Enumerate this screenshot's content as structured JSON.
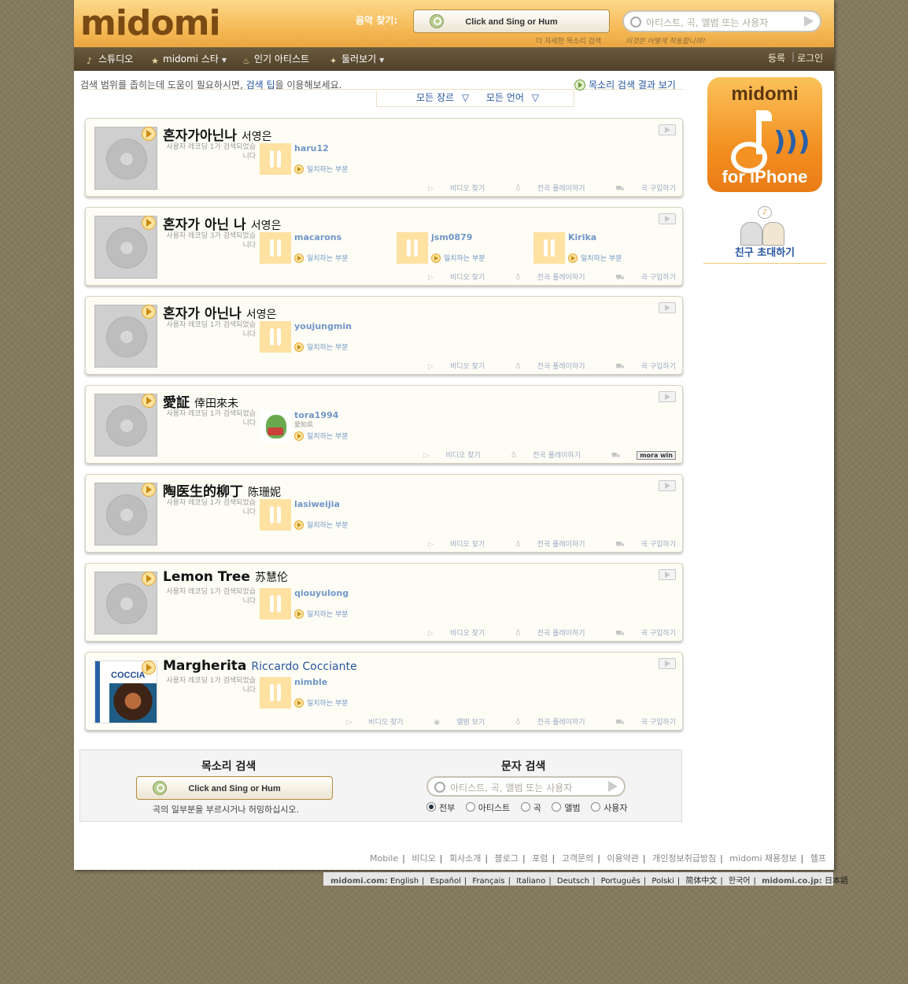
{
  "header": {
    "logo": "midomi",
    "find_music_label": "음악 찾기:",
    "voice_button": "Click and Sing or Hum",
    "search_placeholder": "아티스트, 곡, 앨범 또는 사용자",
    "voice_more": "더 자세한 목소리 검색",
    "how_it_works": "이것은 어떻게 작동합니까?"
  },
  "nav": {
    "items": [
      {
        "label": "스튜디오",
        "icon": "microphone-icon"
      },
      {
        "label": "midomi 스타",
        "icon": "star-icon",
        "dropdown": true
      },
      {
        "label": "인기 아티스트",
        "icon": "flame-icon"
      },
      {
        "label": "둘러보기",
        "icon": "bulb-icon",
        "dropdown": true
      }
    ],
    "register": "등록",
    "login": "로그인"
  },
  "tip": {
    "prefix": "검색 범위를 좁히는데 도움이 필요하시면,",
    "link": "검색 팁",
    "suffix": "을 이용해보세요.",
    "voice_results": "목소리 검색 결과 보기"
  },
  "filters": {
    "genre": "모든 장르",
    "language": "모든 언어"
  },
  "actions": {
    "video": "비디오 찾기",
    "album": "앨범 보기",
    "playlist": "전곡 플레이하기",
    "buy": "곡 구입하기",
    "mora": "mora win"
  },
  "results": [
    {
      "title": "혼자가아닌나",
      "artist": "서영은",
      "rec_count": "사용자 레코딩 1가 검색되었습니다",
      "users": [
        {
          "name": "haru12",
          "match": "일치하는 부분"
        }
      ]
    },
    {
      "title": "혼자가 아닌 나",
      "artist": "서영은",
      "rec_count": "사용자 레코딩 3가 검색되었습니다",
      "users": [
        {
          "name": "macarons",
          "match": "일치하는 부분"
        },
        {
          "name": "jsm0879",
          "match": "일치하는 부분"
        },
        {
          "name": "Kirika",
          "match": "일치하는 부분"
        }
      ]
    },
    {
      "title": "혼자가 아닌나",
      "artist": "서영은",
      "rec_count": "사용자 레코딩 1가 검색되었습니다",
      "users": [
        {
          "name": "youjungmin",
          "match": "일치하는 부분"
        }
      ]
    },
    {
      "title": "愛証",
      "artist": "倖田來未",
      "rec_count": "사용자 레코딩 1가 검색되었습니다",
      "users": [
        {
          "name": "tora1994",
          "location": "愛知県",
          "match": "일치하는 부분"
        }
      ]
    },
    {
      "title": "陶医生的柳丁",
      "artist": "陈珊妮",
      "rec_count": "사용자 레코딩 1가 검색되었습니다",
      "users": [
        {
          "name": "lasiweijia",
          "match": "일치하는 부분"
        }
      ]
    },
    {
      "title": "Lemon Tree",
      "artist": "苏慧伦",
      "rec_count": "사용자 레코딩 1가 검색되었습니다",
      "users": [
        {
          "name": "qiouyulong",
          "match": "일치하는 부분"
        }
      ]
    },
    {
      "title": "Margherita",
      "artist": "Riccardo Cocciante",
      "rec_count": "사용자 레코딩 1가 검색되었습니다",
      "album_label": "COCCIA",
      "users": [
        {
          "name": "nimble",
          "match": "일치하는 부분"
        }
      ]
    }
  ],
  "sidebar": {
    "iphone_top": "midomi",
    "iphone_bottom": "for iPhone",
    "invite": "친구 초대하기"
  },
  "bottom": {
    "voice_heading": "목소리 검색",
    "voice_button": "Click and Sing or Hum",
    "voice_hint": "곡의 일부분을 부르시거나 허밍하십시오.",
    "text_heading": "문자 검색",
    "text_placeholder": "아티스트, 곡, 앨범 또는 사용자",
    "radios": [
      {
        "label": "전부",
        "checked": true
      },
      {
        "label": "아티스트",
        "checked": false
      },
      {
        "label": "곡",
        "checked": false
      },
      {
        "label": "앨범",
        "checked": false
      },
      {
        "label": "사용자",
        "checked": false
      }
    ]
  },
  "footer": {
    "links": [
      "Mobile",
      "비디오",
      "회사소개",
      "블로그",
      "포럼",
      "고객문의",
      "이용약관",
      "개인정보취급방침",
      "midomi 채용정보",
      "헬프"
    ],
    "lang_prefix": "midomi.com:",
    "languages": [
      "English",
      "Español",
      "Français",
      "Italiano",
      "Deutsch",
      "Português",
      "Polski",
      "简体中文",
      "한국어"
    ],
    "jp_prefix": "midomi.co.jp:",
    "jp_lang": "日本語"
  },
  "colors": {
    "accent": "#f4b550",
    "link": "#2656a0",
    "nav_bg": "#5c4d33"
  }
}
